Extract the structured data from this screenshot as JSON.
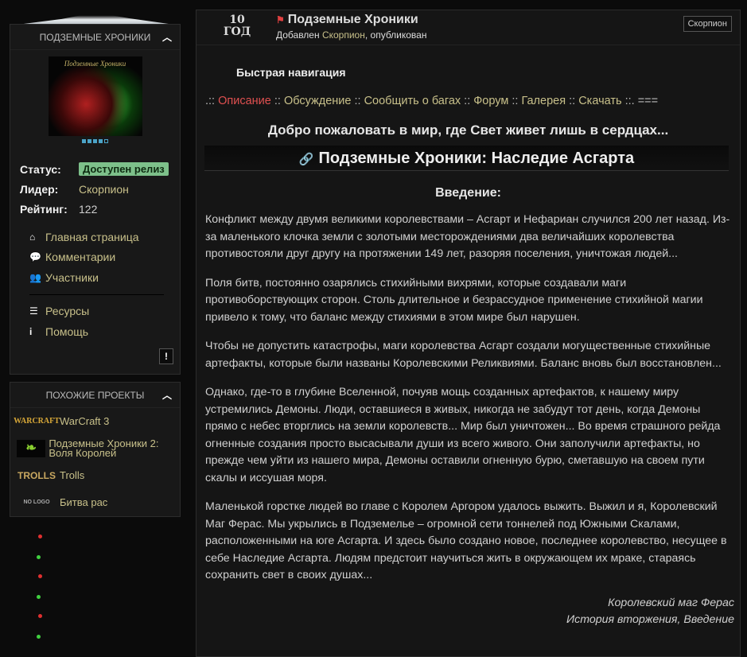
{
  "sidebar": {
    "project_box": {
      "title": "ПОДЗЕМНЫЕ ХРОНИКИ",
      "cover_caption": "Подземные Хроники",
      "status_label": "Статус:",
      "status_value": "Доступен релиз",
      "leader_label": "Лидер:",
      "leader_value": "Скорпион",
      "rating_label": "Рейтинг:",
      "rating_value": "122",
      "menu": [
        {
          "label": "Главная страница",
          "icon": "home-icon"
        },
        {
          "label": "Комментарии",
          "icon": "comments-icon"
        },
        {
          "label": "Участники",
          "icon": "users-icon"
        },
        {
          "label": "Ресурсы",
          "icon": "list-icon"
        },
        {
          "label": "Помощь",
          "icon": "info-icon"
        }
      ],
      "report_label": "!"
    },
    "related_box": {
      "title": "ПОХОЖИЕ ПРОЕКТЫ",
      "items": [
        {
          "label": "WarCraft 3",
          "logo": "WARCRAFT"
        },
        {
          "label": "Подземные Хроники 2: Воля Королей"
        },
        {
          "label": "Trolls",
          "logo": "TROLLS"
        },
        {
          "label": "Битва рас",
          "logo": "NO LOGO"
        }
      ]
    }
  },
  "main": {
    "age_num": "10",
    "age_unit": "ГОД",
    "title": "Подземные Хроники",
    "added_prefix": "Добавлен ",
    "added_by": "Скорпион",
    "added_suffix": ", опубликован",
    "author_tag": "Скорпион",
    "quick_nav": "Быстрая навигация",
    "nav": {
      "pre": ".:: ",
      "items": [
        "Описание",
        "Обсуждение",
        "Сообщить о багах",
        "Форум",
        "Галерея",
        "Скачать"
      ],
      "sep": " :: ",
      "post": " ::. ==="
    },
    "welcome": "Добро пожаловать в мир, где Свет живет лишь в сердцах...",
    "heading": "Подземные Хроники: Наследие Асгарта",
    "intro": "Введение:",
    "paragraphs": [
      "Конфликт между двумя великими королевствами – Асгарт и Нефариан случился 200 лет назад. Из-за маленького клочка земли с золотыми месторождениями два величайших королевства противостояли друг другу на протяжении 149 лет, разоряя поселения, уничтожая людей...",
      "Поля битв, постоянно озарялись стихийными вихрями, которые создавали маги противоборствующих сторон. Столь длительное и безрассудное применение стихийной магии привело к тому, что баланс между стихиями в этом мире был нарушен.",
      "Чтобы не допустить катастрофы, маги королевства Асгарт создали могущественные стихийные артефакты, которые были названы Королевскими Реликвиями. Баланс вновь был восстановлен...",
      "Однако, где-то в глубине Вселенной, почуяв мощь созданных артефактов, к нашему миру устремились Демоны. Люди, оставшиеся в живых, никогда не забудут тот день, когда Демоны прямо с небес вторглись на земли королевств... Мир был уничтожен... Во время страшного рейда огненные создания просто высасывали души из всего живого. Они заполучили артефакты, но прежде чем уйти из нашего мира, Демоны оставили огненную бурю, сметавшую на своем пути скалы и иссушая моря.",
      "Маленькой горстке людей во главе с Королем Аргором удалось выжить. Выжил и я, Королевский Маг Ферас. Мы укрылись в Подземелье – огромной сети тоннелей под Южными Скалами, расположенными на юге Асгарта. И здесь было создано новое, последнее королевство, несущее в себе Наследие Асгарта. Людям предстоит научиться жить в окружающем их мраке, стараясь сохранить свет в своих душах..."
    ],
    "signature_1": "Королевский маг Ферас",
    "signature_2": "История вторжения, Введение"
  }
}
